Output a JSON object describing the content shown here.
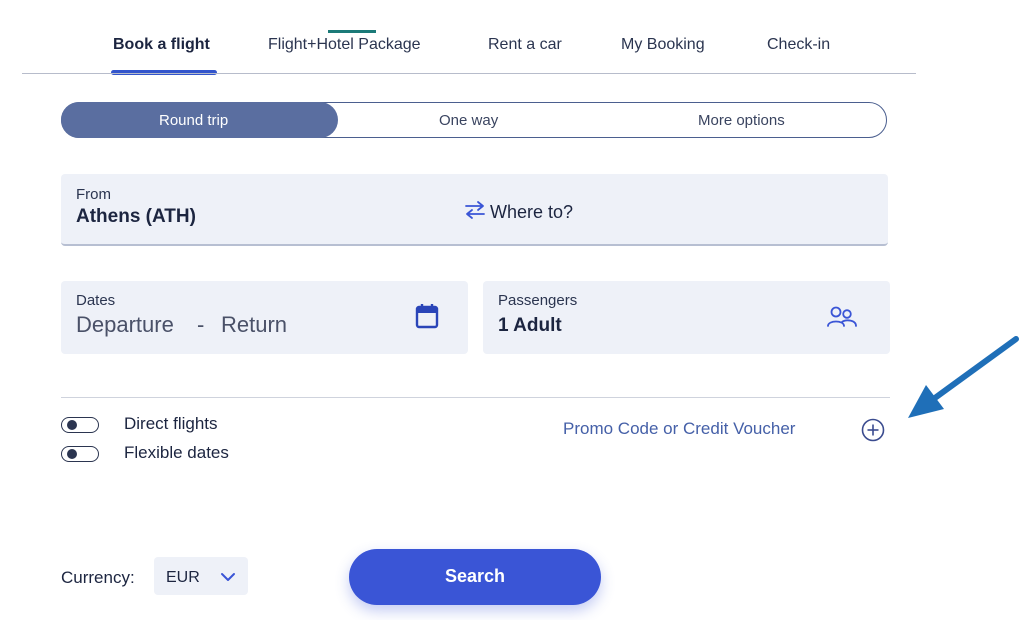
{
  "nav": {
    "tabs": [
      {
        "label": "Book a flight",
        "active": true
      },
      {
        "label": "Flight+Hotel Package",
        "active": false
      },
      {
        "label": "Rent a car",
        "active": false
      },
      {
        "label": "My Booking",
        "active": false
      },
      {
        "label": "Check-in",
        "active": false
      }
    ]
  },
  "trip_type": {
    "options": [
      "Round trip",
      "One way",
      "More options"
    ],
    "selected": "Round trip"
  },
  "route": {
    "from_label": "From",
    "from_value": "Athens (ATH)",
    "swap_icon": "swap-arrows-icon",
    "to_placeholder": "Where to?"
  },
  "dates": {
    "label": "Dates",
    "departure_placeholder": "Departure",
    "separator": "-",
    "return_placeholder": "Return",
    "icon": "calendar-icon"
  },
  "passengers": {
    "label": "Passengers",
    "value": "1 Adult",
    "icon": "people-icon"
  },
  "options": {
    "direct_flights_label": "Direct flights",
    "flexible_dates_label": "Flexible dates",
    "promo_label": "Promo Code or Credit Voucher",
    "promo_icon": "plus-circle-icon"
  },
  "currency": {
    "label": "Currency:",
    "value": "EUR",
    "icon": "chevron-down-icon"
  },
  "search": {
    "label": "Search"
  },
  "colors": {
    "accent": "#3a55d6",
    "active_segment": "#5a6ea0",
    "field_bg": "#eef1f8",
    "annotation_arrow": "#1f6fb8"
  }
}
